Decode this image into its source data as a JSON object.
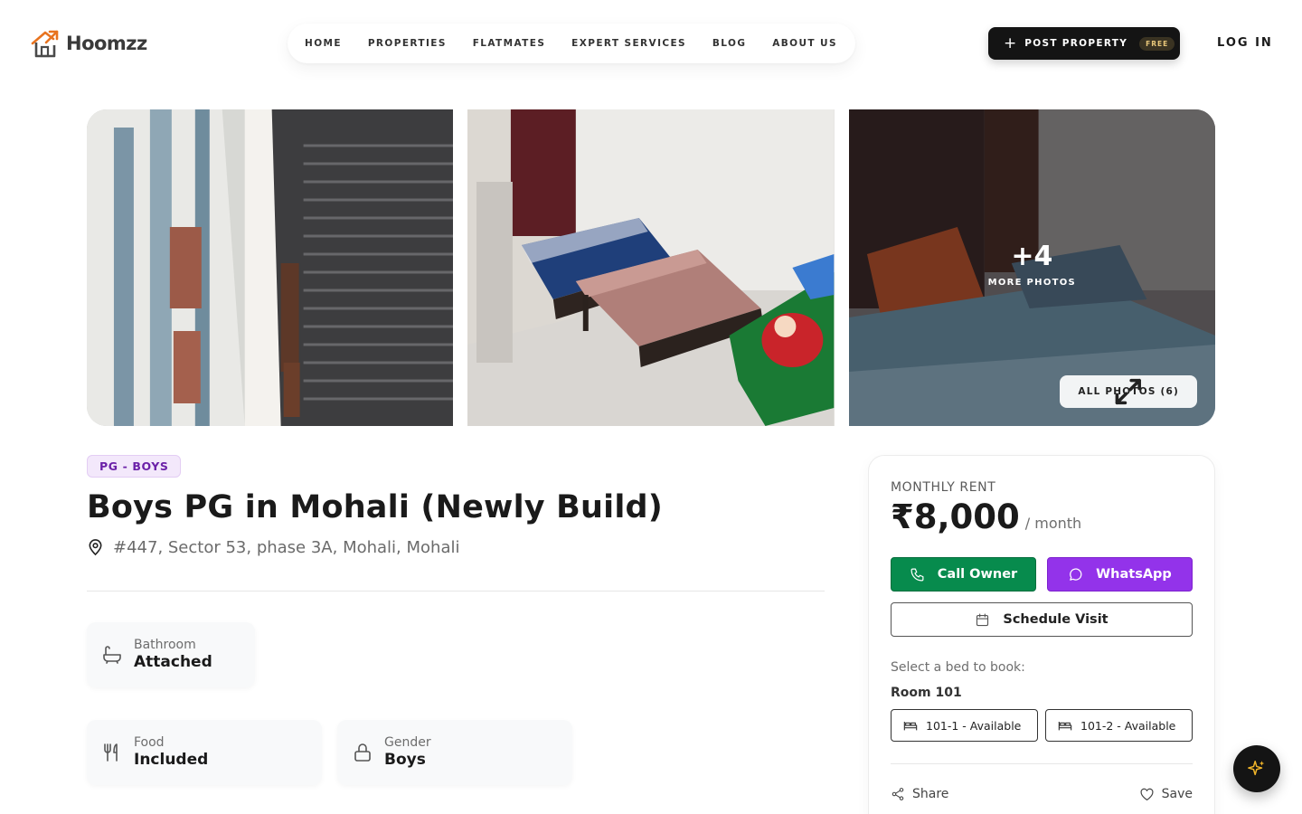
{
  "header": {
    "logo_text": "Hoomzz",
    "nav": [
      "HOME",
      "PROPERTIES",
      "FLATMATES",
      "EXPERT SERVICES",
      "BLOG",
      "ABOUT US"
    ],
    "post_property": "POST PROPERTY",
    "free_badge": "FREE",
    "login": "LOG IN"
  },
  "gallery": {
    "more_count": "+4",
    "more_label": "MORE PHOTOS",
    "all_photos": "ALL PHOTOS (6)"
  },
  "listing": {
    "tag": "PG - BOYS",
    "title": "Boys PG in Mohali (Newly Build)",
    "address": "#447, Sector 53, phase 3A, Mohali, Mohali",
    "features": [
      {
        "label": "Bathroom",
        "value": "Attached",
        "icon": "bathtub-icon"
      },
      {
        "label": "Food",
        "value": "Included",
        "icon": "utensils-icon"
      },
      {
        "label": "Gender",
        "value": "Boys",
        "icon": "lock-icon"
      }
    ]
  },
  "booking": {
    "rent_label": "MONTHLY RENT",
    "rent_amount": "₹8,000",
    "rent_period": "/ month",
    "call_owner": "Call Owner",
    "whatsapp": "WhatsApp",
    "schedule_visit": "Schedule Visit",
    "bed_prompt": "Select a bed to book:",
    "room": "Room 101",
    "beds": [
      "101-1 - Available",
      "101-2 - Available"
    ],
    "share": "Share",
    "save": "Save"
  },
  "colors": {
    "call_green": "#078b4d",
    "whatsapp_purple": "#9333ea",
    "tag_bg": "#f3e8fb",
    "tag_text": "#6b21a8",
    "logo_orange": "#e8731f"
  }
}
